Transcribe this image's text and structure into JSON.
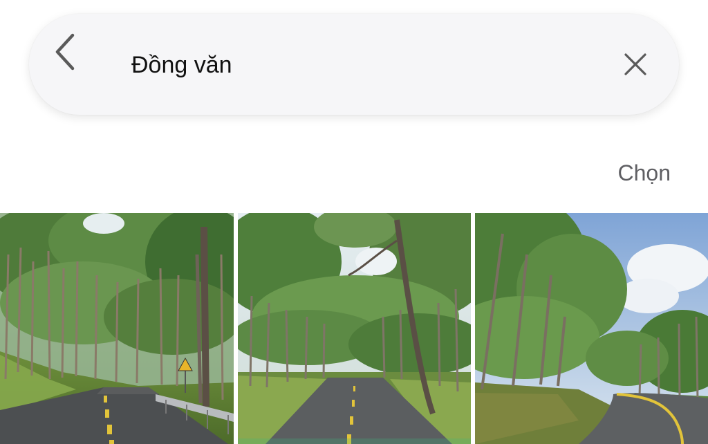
{
  "search": {
    "query": "Đồng văn",
    "back_icon": "chevron-left-icon",
    "clear_icon": "close-icon"
  },
  "toolbar": {
    "select_label": "Chọn"
  },
  "photos": [
    {
      "name": "pine-forest-road-with-sign-and-guardrail"
    },
    {
      "name": "pine-forest-road-straight"
    },
    {
      "name": "pine-forest-curved-road-blue-sky"
    }
  ],
  "colors": {
    "search_bg": "#f6f6f8",
    "text": "#111111",
    "secondary_text": "#5f5f63",
    "icon": "#555555"
  }
}
